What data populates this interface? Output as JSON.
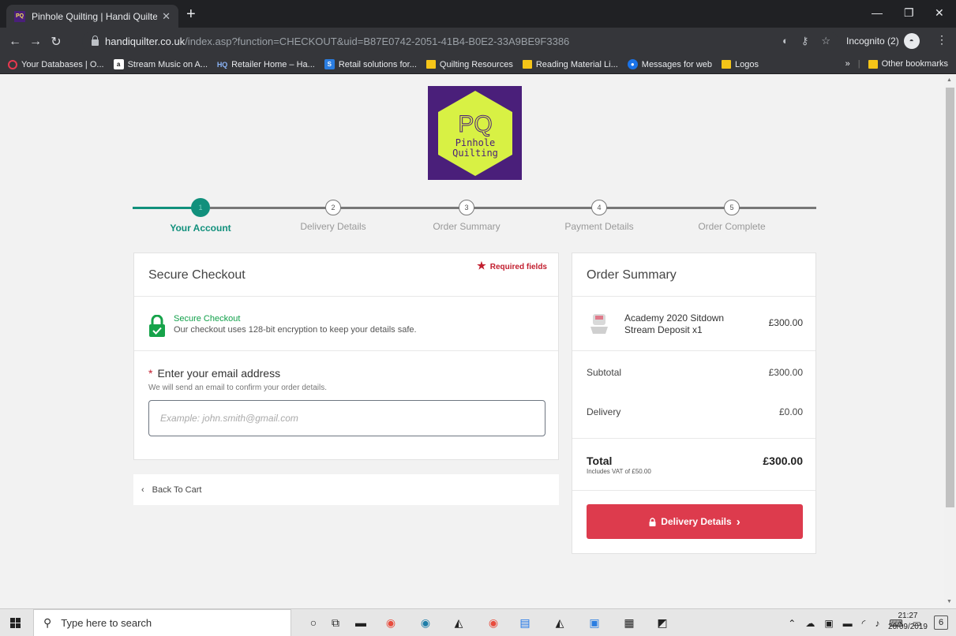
{
  "browser": {
    "tab_title": "Pinhole Quilting | Handi Quilter L",
    "tab_favicon": "PQ",
    "url_host": "handiquilter.co.uk",
    "url_path": "/index.asp?function=CHECKOUT&uid=B87E0742-2051-41B4-B0E2-33A9BE9F3386",
    "incognito_label": "Incognito (2)",
    "bookmarks": [
      {
        "label": "Your Databases | O...",
        "icon": "opera-icon"
      },
      {
        "label": "Stream Music on A...",
        "icon": "amazon-icon"
      },
      {
        "label": "Retailer Home – Ha...",
        "icon": "hq-icon"
      },
      {
        "label": "Retail solutions for...",
        "icon": "shopify-icon"
      },
      {
        "label": "Quilting Resources",
        "icon": "folder-icon"
      },
      {
        "label": "Reading Material Li...",
        "icon": "folder-icon"
      },
      {
        "label": "Messages for web",
        "icon": "messages-icon"
      },
      {
        "label": "Logos",
        "icon": "folder-icon"
      }
    ],
    "bookmarks_more": "»",
    "other_bookmarks": "Other bookmarks"
  },
  "logo": {
    "letters": "PQ",
    "line1": "Pinhole",
    "line2": "Quilting"
  },
  "progress": {
    "steps": [
      {
        "num": "1",
        "label": "Your Account"
      },
      {
        "num": "2",
        "label": "Delivery Details"
      },
      {
        "num": "3",
        "label": "Order Summary"
      },
      {
        "num": "4",
        "label": "Payment Details"
      },
      {
        "num": "5",
        "label": "Order Complete"
      }
    ],
    "current": 1
  },
  "checkout": {
    "required_label": "Required fields",
    "heading": "Secure Checkout",
    "secure_title": "Secure Checkout",
    "secure_text": "Our checkout uses 128-bit encryption to keep your details safe.",
    "email_label": "Enter your email address",
    "email_help": "We will send an email to confirm your order details.",
    "email_placeholder": "Example: john.smith@gmail.com",
    "email_value": "",
    "back_label": "Back To Cart"
  },
  "summary": {
    "heading": "Order Summary",
    "item_name": "Academy 2020 Sitdown Stream Deposit x1",
    "item_price": "£300.00",
    "subtotal_label": "Subtotal",
    "subtotal_value": "£300.00",
    "delivery_label": "Delivery",
    "delivery_value": "£0.00",
    "total_label": "Total",
    "total_vat": "Includes VAT of £50.00",
    "total_value": "£300.00",
    "cta_label": "Delivery Details"
  },
  "colors": {
    "accent": "#11907c",
    "cta": "#dd3b4d",
    "required": "#c21e2e",
    "secure": "#11a04a",
    "logo_bg": "#4a1f7a",
    "logo_hex": "#d8f144"
  },
  "taskbar": {
    "search_placeholder": "Type here to search",
    "time": "21:27",
    "date": "20/09/2019",
    "notifications": "6"
  }
}
